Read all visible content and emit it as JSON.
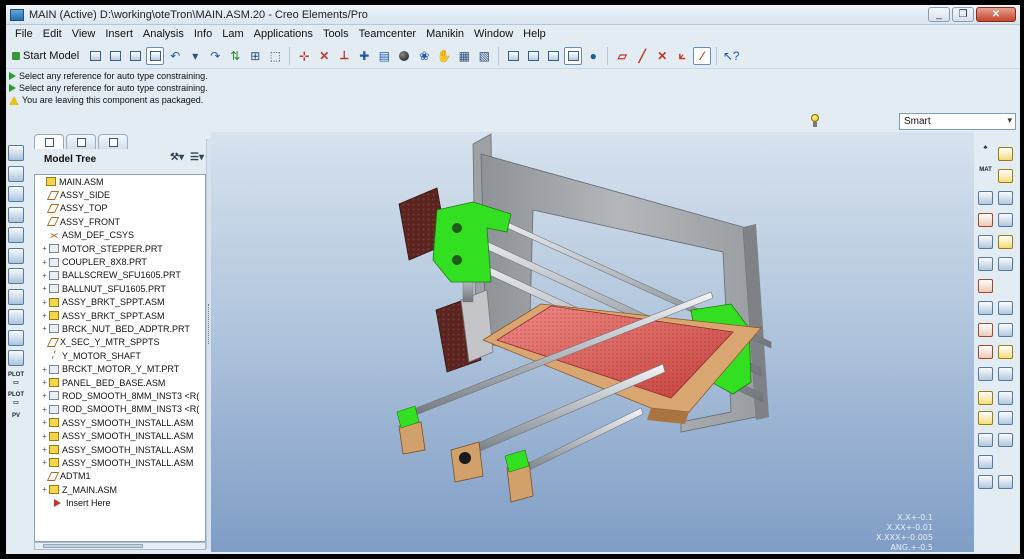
{
  "window": {
    "title": "MAIN (Active) D:\\working\\oteTron\\MAIN.ASM.20 - Creo Elements/Pro",
    "minimize": "_",
    "maximize": "❐",
    "close": "✕"
  },
  "menu": [
    "File",
    "Edit",
    "View",
    "Insert",
    "Analysis",
    "Info",
    "Lam",
    "Applications",
    "Tools",
    "Teamcenter",
    "Manikin",
    "Window",
    "Help"
  ],
  "toolbar": {
    "start_model": "Start Model"
  },
  "messages": [
    {
      "icon": "green-arrow-icon",
      "text": "Select any reference for auto type constraining."
    },
    {
      "icon": "green-arrow-icon",
      "text": "Select any reference for auto type constraining."
    },
    {
      "icon": "warning-icon",
      "text": "You are leaving this component as packaged."
    }
  ],
  "filter": {
    "value": "Smart"
  },
  "model_tree": {
    "title": "Model Tree",
    "rows": [
      {
        "label": "MAIN.ASM",
        "icon": "asm",
        "expander": "",
        "indent": 0
      },
      {
        "label": "ASSY_SIDE",
        "icon": "plane",
        "expander": "",
        "indent": 1
      },
      {
        "label": "ASSY_TOP",
        "icon": "plane",
        "expander": "",
        "indent": 1
      },
      {
        "label": "ASSY_FRONT",
        "icon": "plane",
        "expander": "",
        "indent": 1
      },
      {
        "label": "ASM_DEF_CSYS",
        "icon": "csys",
        "expander": "",
        "indent": 1
      },
      {
        "label": "MOTOR_STEPPER.PRT",
        "icon": "prt",
        "expander": "+",
        "indent": 1
      },
      {
        "label": "COUPLER_8X8.PRT",
        "icon": "prt",
        "expander": "+",
        "indent": 1
      },
      {
        "label": "BALLSCREW_SFU1605.PRT",
        "icon": "prt",
        "expander": "+",
        "indent": 1
      },
      {
        "label": "BALLNUT_SFU1605.PRT",
        "icon": "prt",
        "expander": "+",
        "indent": 1
      },
      {
        "label": "ASSY_BRKT_SPPT.ASM",
        "icon": "asm",
        "expander": "+",
        "indent": 1
      },
      {
        "label": "ASSY_BRKT_SPPT.ASM",
        "icon": "asm",
        "expander": "+",
        "indent": 1
      },
      {
        "label": "BRCK_NUT_BED_ADPTR.PRT",
        "icon": "prt",
        "expander": "+",
        "indent": 1
      },
      {
        "label": "X_SEC_Y_MTR_SPPTS",
        "icon": "plane",
        "expander": "",
        "indent": 1
      },
      {
        "label": "Y_MOTOR_SHAFT",
        "icon": "axis",
        "expander": "",
        "indent": 1
      },
      {
        "label": "BRCKT_MOTOR_Y_MT.PRT",
        "icon": "prt",
        "expander": "+",
        "indent": 1
      },
      {
        "label": "PANEL_BED_BASE.ASM",
        "icon": "asm",
        "expander": "+",
        "indent": 1
      },
      {
        "label": "ROD_SMOOTH_8MM_INST3 <R(",
        "icon": "prt",
        "expander": "+",
        "indent": 1
      },
      {
        "label": "ROD_SMOOTH_8MM_INST3 <R(",
        "icon": "prt",
        "expander": "+",
        "indent": 1
      },
      {
        "label": "ASSY_SMOOTH_INSTALL.ASM",
        "icon": "asm",
        "expander": "+",
        "indent": 1
      },
      {
        "label": "ASSY_SMOOTH_INSTALL.ASM",
        "icon": "asm",
        "expander": "+",
        "indent": 1
      },
      {
        "label": "ASSY_SMOOTH_INSTALL.ASM",
        "icon": "asm",
        "expander": "+",
        "indent": 1
      },
      {
        "label": "ASSY_SMOOTH_INSTALL.ASM",
        "icon": "asm",
        "expander": "+",
        "indent": 1
      },
      {
        "label": "ADTM1",
        "icon": "plane",
        "expander": "",
        "indent": 1
      },
      {
        "label": "Z_MAIN.ASM",
        "icon": "asm",
        "expander": "+",
        "indent": 1
      },
      {
        "label": "Insert Here",
        "icon": "ins",
        "expander": "",
        "indent": 1
      }
    ]
  },
  "tolerances": [
    "X.X+-0.1",
    "X.XX+-0.01",
    "X.XXX+-0.005",
    "ANG.+-0.5"
  ],
  "colors": {
    "viewport_top": "#d7e2ee",
    "viewport_bottom": "#7f9dc6",
    "green_brackets": "#33e021",
    "bed_red": "#d9534f",
    "frame_gray": "#a4a7ab",
    "motor_brown": "#6b2a24",
    "wood": "#d9a672"
  }
}
